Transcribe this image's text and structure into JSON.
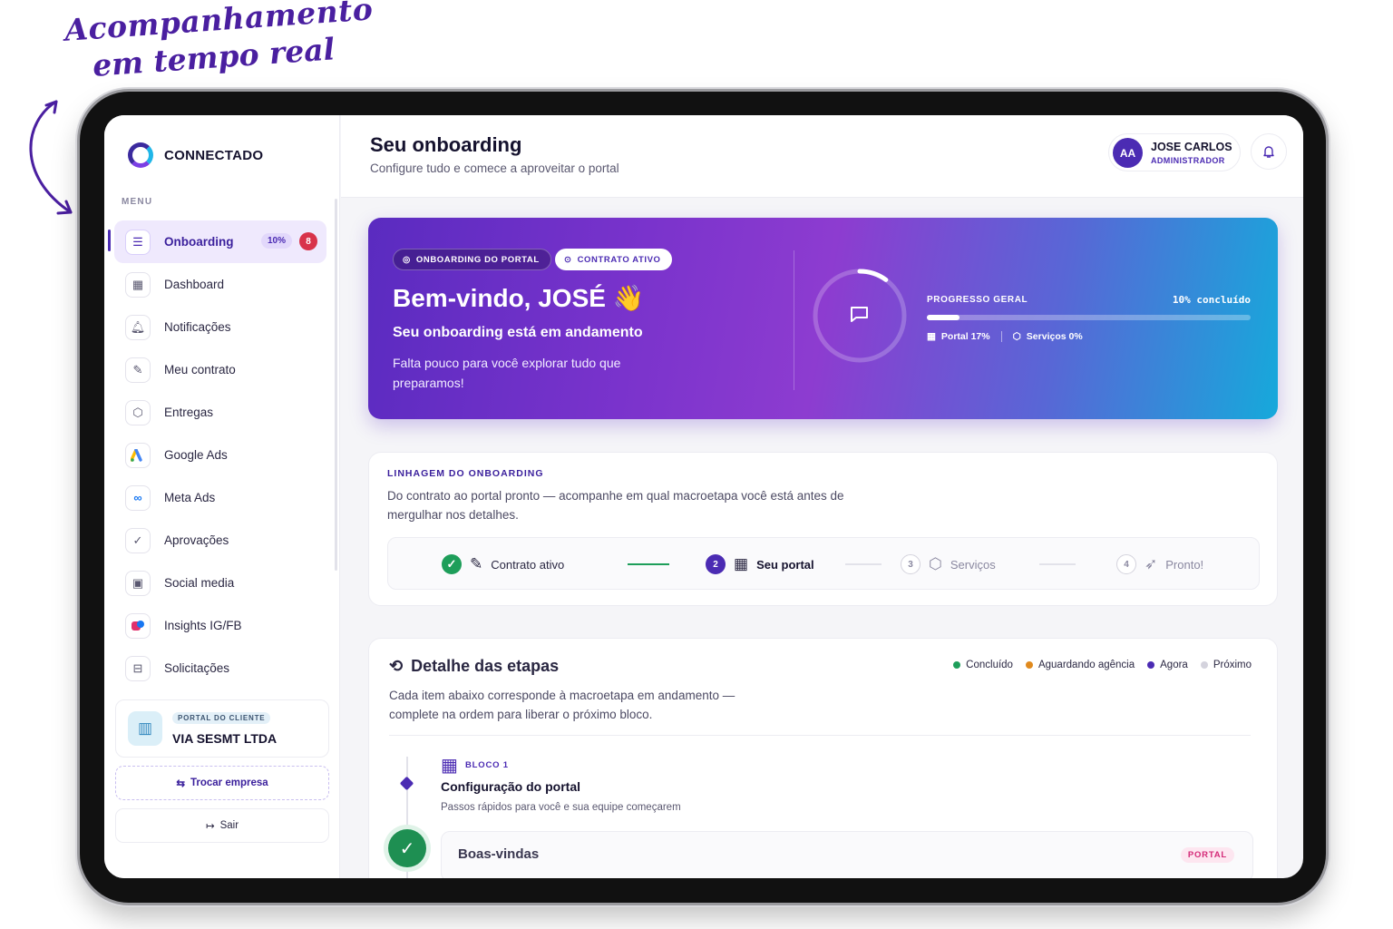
{
  "annotation": {
    "line1": "Acompanhamento",
    "line2": "em tempo real"
  },
  "brand": {
    "name": "CONNECTADO"
  },
  "sidebar": {
    "menu_label": "MENU",
    "items": [
      {
        "label": "Onboarding",
        "icon": "checklist-icon",
        "active": true,
        "pct": "10%",
        "badge": "8"
      },
      {
        "label": "Dashboard",
        "icon": "grid-icon"
      },
      {
        "label": "Notificações",
        "icon": "bell-icon"
      },
      {
        "label": "Meu contrato",
        "icon": "document-edit-icon"
      },
      {
        "label": "Entregas",
        "icon": "package-icon"
      },
      {
        "label": "Google Ads",
        "icon": "google-ads-icon"
      },
      {
        "label": "Meta Ads",
        "icon": "meta-icon"
      },
      {
        "label": "Aprovações",
        "icon": "check-circle-icon"
      },
      {
        "label": "Social media",
        "icon": "calendar-icon"
      },
      {
        "label": "Insights IG/FB",
        "icon": "instagram-facebook-icon"
      },
      {
        "label": "Solicitações",
        "icon": "inbox-icon"
      }
    ],
    "client": {
      "tag": "PORTAL DO CLIENTE",
      "name": "VIA SESMT LTDA"
    },
    "switch_label": "Trocar empresa",
    "logout_label": "Sair"
  },
  "header": {
    "title": "Seu onboarding",
    "subtitle": "Configure tudo e comece a aproveitar o portal",
    "user": {
      "initials": "AA",
      "name": "JOSE CARLOS",
      "role": "ADMINISTRADOR"
    }
  },
  "hero": {
    "pill_portal": "ONBOARDING DO PORTAL",
    "pill_contract": "CONTRATO ATIVO",
    "title": "Bem-vindo, JOSÉ 👋",
    "subtitle": "Seu onboarding está em andamento",
    "description": "Falta pouco para você explorar tudo que preparamos!",
    "progress_label": "PROGRESSO GERAL",
    "progress_value": "10% concluído",
    "progress_fraction": 0.1,
    "portal_label": "Portal 17%",
    "services_label": "Serviços 0%"
  },
  "lineage": {
    "label": "LINHAGEM DO ONBOARDING",
    "description": "Do contrato ao portal pronto — acompanhe em qual macroetapa você está antes de mergulhar nos detalhes.",
    "steps": [
      {
        "num": "✓",
        "label": "Contrato ativo",
        "status": "done"
      },
      {
        "num": "2",
        "label": "Seu portal",
        "status": "current"
      },
      {
        "num": "3",
        "label": "Serviços",
        "status": "next"
      },
      {
        "num": "4",
        "label": "Pronto!",
        "status": "next"
      }
    ]
  },
  "detail": {
    "title": "Detalhe das etapas",
    "description": "Cada item abaixo corresponde à macroetapa em andamento — complete na ordem para liberar o próximo bloco.",
    "legend": [
      {
        "label": "Concluído",
        "color": "#1e9e5a"
      },
      {
        "label": "Aguardando agência",
        "color": "#e08a1e"
      },
      {
        "label": "Agora",
        "color": "#4b2bb3"
      },
      {
        "label": "Próximo",
        "color": "#d4d3dd"
      }
    ],
    "block": {
      "label": "BLOCO 1",
      "title": "Configuração do portal",
      "subtitle": "Passos rápidos para você e sua equipe começarem"
    },
    "task": {
      "title": "Boas-vindas",
      "tag": "PORTAL"
    }
  }
}
